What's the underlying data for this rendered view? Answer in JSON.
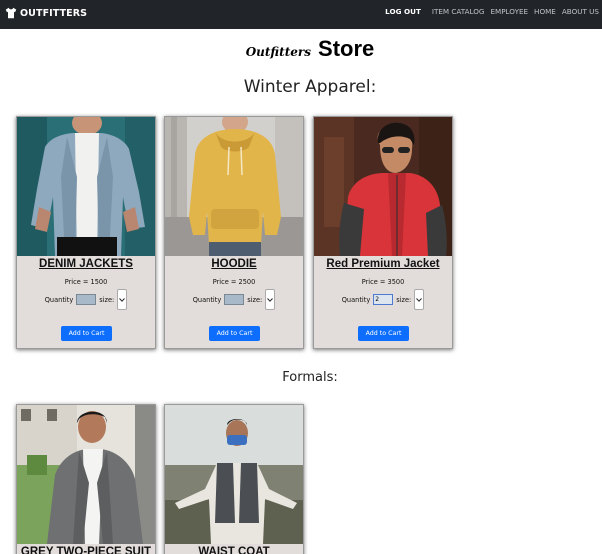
{
  "navbar": {
    "brand": "OUTFITTERS",
    "links": [
      {
        "label": "LOG OUT",
        "active": true
      },
      {
        "label": "ITEM CATALOG",
        "active": false
      },
      {
        "label": "EMPLOYEE",
        "active": false
      },
      {
        "label": "HOME",
        "active": false
      },
      {
        "label": "ABOUT US",
        "active": false
      }
    ]
  },
  "store": {
    "brand_script": "Outfitters",
    "store_word": "Store"
  },
  "sections": {
    "winter": "Winter Apparel:",
    "formals": "Formals:"
  },
  "winter_products": [
    {
      "name": "DENIM JACKETS",
      "price": "Price = 1500",
      "qty_label": "Quantity",
      "qty_value": "",
      "size_label": "size:",
      "button": "Add to Cart"
    },
    {
      "name": "HOODIE",
      "price": "Price = 2500",
      "qty_label": "Quantity",
      "qty_value": "",
      "size_label": "size:",
      "button": "Add to Cart"
    },
    {
      "name": "Red Premium Jacket",
      "price": "Price = 3500",
      "qty_label": "Quantity",
      "qty_value": "2",
      "size_label": "size:",
      "button": "Add to Cart"
    }
  ],
  "formal_products": [
    {
      "name": "GREY TWO-PIECE SUIT"
    },
    {
      "name": "WAIST COAT"
    }
  ],
  "colors": {
    "navbar_bg": "#212529",
    "card_bg": "#e2dcda",
    "button": "#0d6efd"
  },
  "icons": {
    "brand": "tshirt-icon",
    "select": "chevron-down-icon"
  }
}
